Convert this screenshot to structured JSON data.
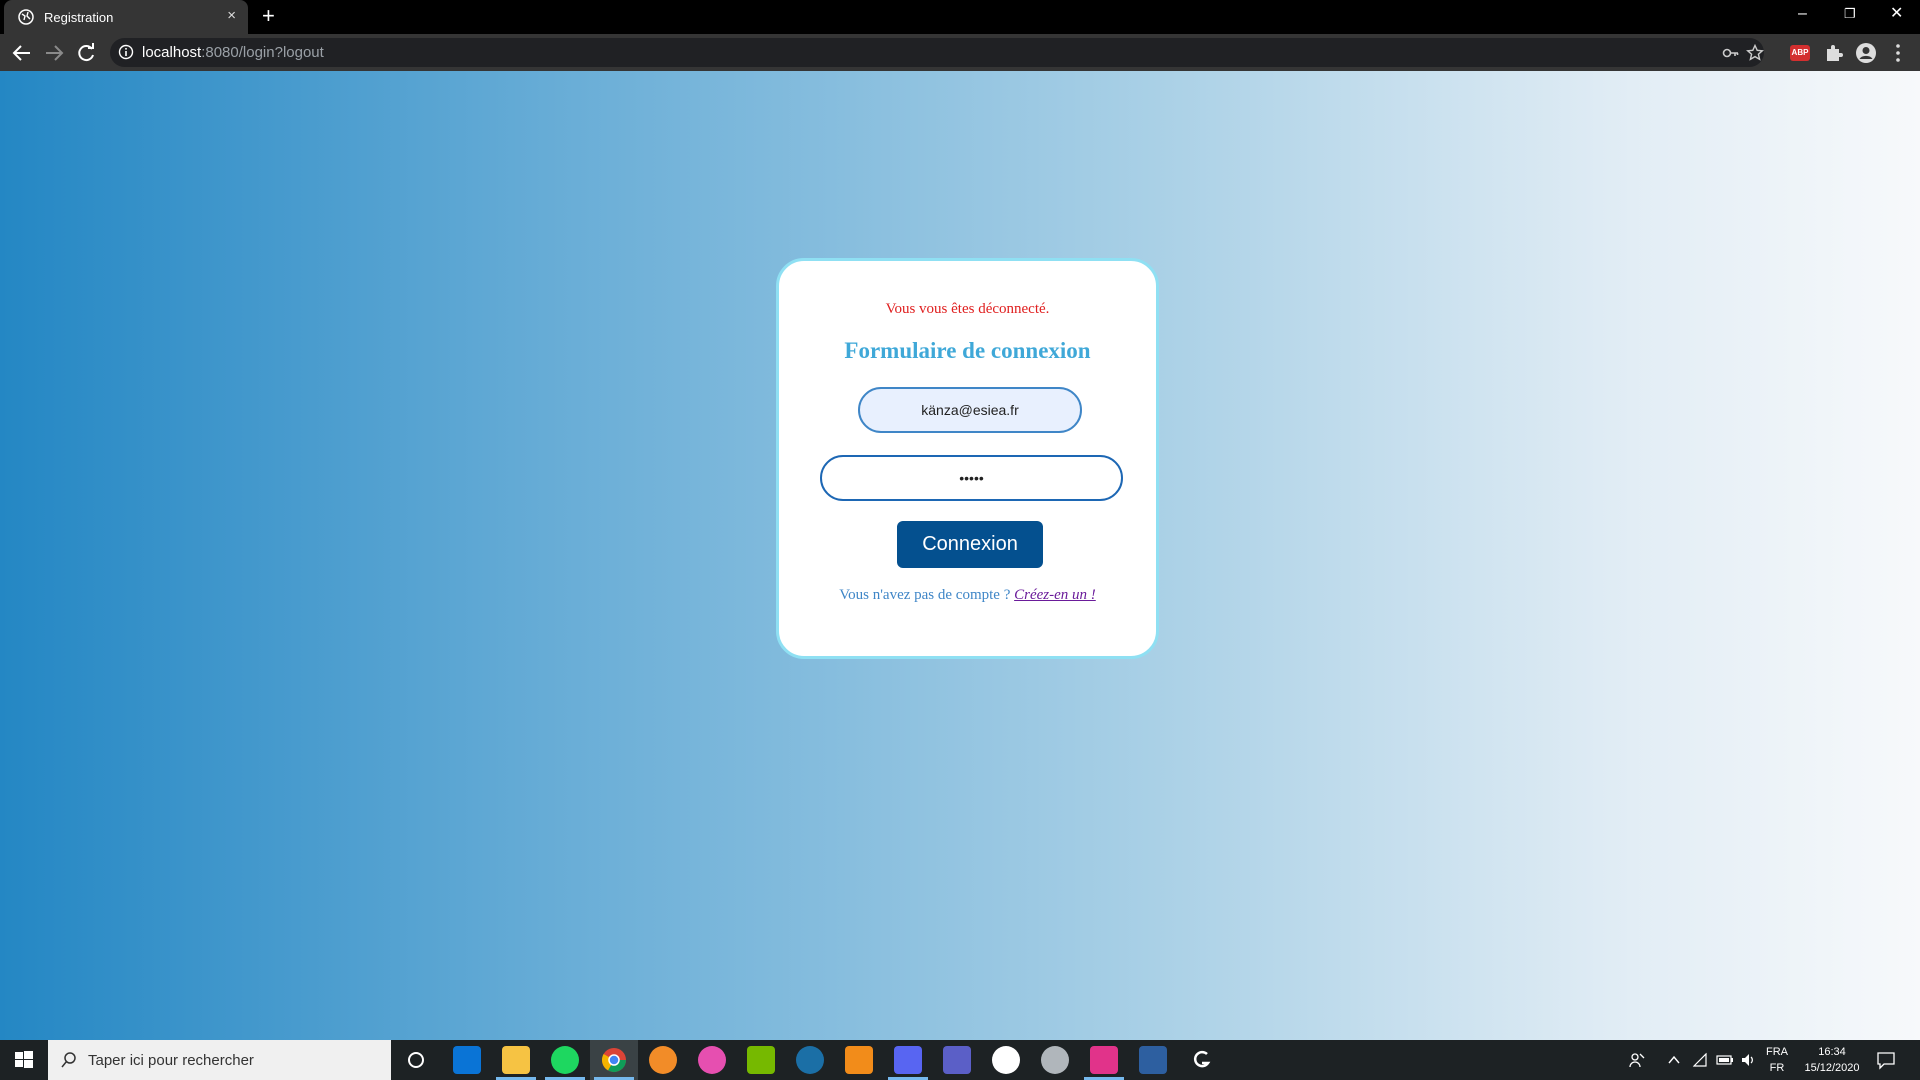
{
  "browser": {
    "tab_title": "Registration",
    "tab_close": "×",
    "new_tab": "+",
    "url_host": "localhost",
    "url_path": ":8080/login?logout",
    "window_controls": {
      "minimize": "–",
      "restore": "❐",
      "close": "✕"
    }
  },
  "login": {
    "logout_message": "Vous vous êtes déconnecté.",
    "heading": "Formulaire de connexion",
    "email_value": "känza@esiea.fr",
    "password_value": "•••••",
    "submit_label": "Connexion",
    "no_account_text": "Vous n'avez pas de compte ? ",
    "create_link": "Créez-en un !"
  },
  "taskbar": {
    "search_placeholder": "Taper ici pour rechercher",
    "lang_top": "FRA",
    "lang_bottom": "FR",
    "time": "16:34",
    "date": "15/12/2020",
    "apps": [
      "cortana-icon",
      "mail-icon",
      "file-explorer-icon",
      "spotify-icon",
      "chrome-icon",
      "fl-studio-icon",
      "itunes-icon",
      "nvidia-icon",
      "steam-icon",
      "sublime-text-icon",
      "discord-icon",
      "teams-icon",
      "obs-icon",
      "app-icon",
      "intellij-icon",
      "ssms-icon",
      "logitech-icon"
    ]
  },
  "colors": {
    "card_border": "#8fe0f3",
    "heading": "#3fa8d8",
    "error": "#e02020",
    "button": "#04508f",
    "link": "#6a1b9a"
  }
}
